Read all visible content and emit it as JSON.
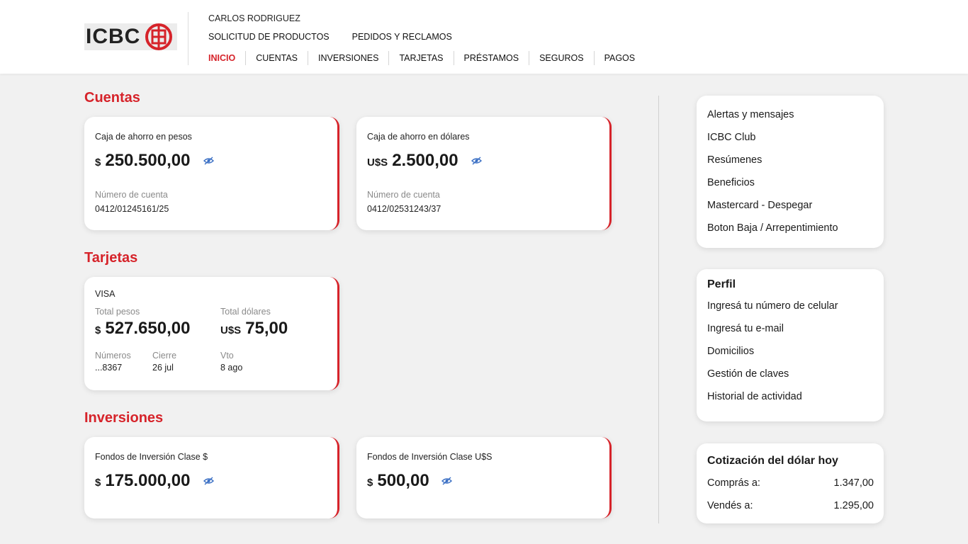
{
  "header": {
    "logo_text": "ICBC",
    "user_name": "CARLOS RODRIGUEZ",
    "top_links": [
      "SOLICITUD DE PRODUCTOS",
      "PEDIDOS Y RECLAMOS"
    ],
    "nav": [
      "INICIO",
      "CUENTAS",
      "INVERSIONES",
      "TARJETAS",
      "PRÉSTAMOS",
      "SEGUROS",
      "PAGOS"
    ],
    "active_nav": "INICIO"
  },
  "cuentas": {
    "title": "Cuentas",
    "accounts": [
      {
        "label": "Caja de ahorro en pesos",
        "currency": "$",
        "amount": "250.500,00",
        "number_label": "Número de cuenta",
        "number": "0412/01245161/25"
      },
      {
        "label": "Caja de ahorro en dólares",
        "currency": "U$S",
        "amount": "2.500,00",
        "number_label": "Número de cuenta",
        "number": "0412/02531243/37"
      }
    ]
  },
  "tarjetas": {
    "title": "Tarjetas",
    "card": {
      "brand": "VISA",
      "pesos_label": "Total pesos",
      "pesos_currency": "$",
      "pesos_amount": "527.650,00",
      "dolares_label": "Total dólares",
      "dolares_currency": "U$S",
      "dolares_amount": "75,00",
      "numeros_label": "Números",
      "numeros": "...8367",
      "cierre_label": "Cierre",
      "cierre": "26 jul",
      "vto_label": "Vto",
      "vto": "8 ago"
    }
  },
  "inversiones": {
    "title": "Inversiones",
    "funds": [
      {
        "label": "Fondos de Inversión Clase $",
        "currency": "$",
        "amount": "175.000,00"
      },
      {
        "label": "Fondos de Inversión Clase U$S",
        "currency": "$",
        "amount": "500,00"
      }
    ]
  },
  "sidebar": {
    "links": [
      "Alertas y mensajes",
      "ICBC Club",
      "Resúmenes",
      "Beneficios",
      "Mastercard - Despegar",
      "Boton Baja / Arrepentimiento"
    ],
    "perfil": {
      "title": "Perfil",
      "items": [
        "Ingresá tu número de celular",
        "Ingresá tu e-mail",
        "Domicilios",
        "Gestión de claves",
        "Historial de actividad"
      ]
    },
    "cotizacion": {
      "title": "Cotización del dólar hoy",
      "buy_label": "Comprás a:",
      "buy_value": "1.347,00",
      "sell_label": "Vendés a:",
      "sell_value": "1.295,00"
    }
  },
  "colors": {
    "accent": "#d6232a",
    "eye_icon": "#3a6fc4"
  }
}
